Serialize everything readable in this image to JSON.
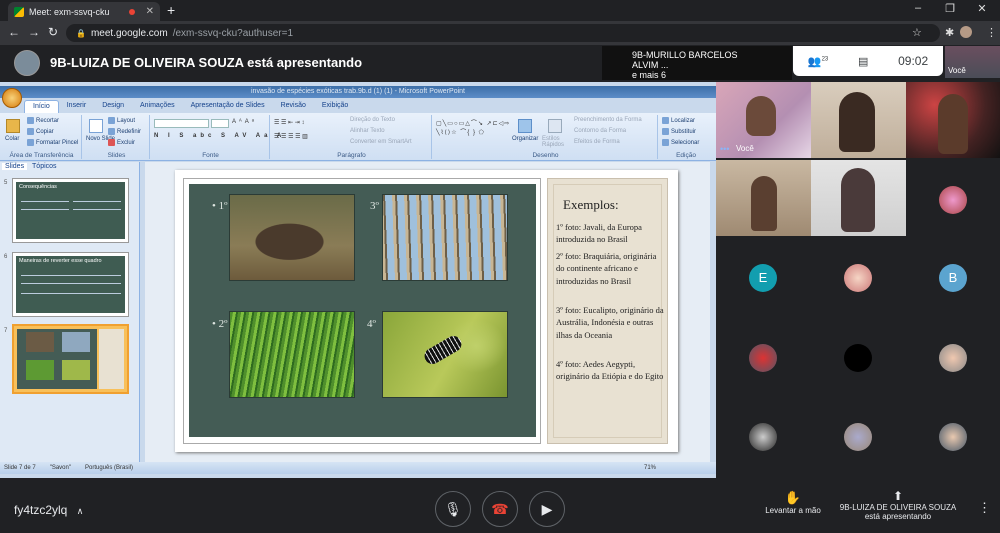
{
  "browser": {
    "tab_title": "Meet: exm-ssvq-cku",
    "url_host": "meet.google.com",
    "url_path": "/exm-ssvq-cku?authuser=1",
    "new_tab": "+",
    "minimize": "–",
    "maximize": "❐",
    "close": "✕",
    "back": "←",
    "forward": "→",
    "reload": "↻",
    "star": "☆",
    "extensions": "✱",
    "menu": "⋮"
  },
  "meet": {
    "presenting_banner": "9B-LUIZA DE OLIVEIRA SOUZA está apresentando",
    "pinned_name": "9B-MURILLO BARCELOS ALVIM ...",
    "pinned_more": "e mais 6",
    "participants_count": "23",
    "time": "09:02",
    "self_label": "Você",
    "meeting_code": "fy4tzc2ylq",
    "raise_hand_label": "Levantar a mão",
    "presenter_label": "9B-LUIZA DE OLIVEIRA SOUZA",
    "presenter_sub": "está apresentando",
    "tile_letters": [
      "E",
      "B"
    ]
  },
  "powerpoint": {
    "window_title": "invasão de espécies exóticas trab.9b.d (1) (1) - Microsoft PowerPoint",
    "tabs": [
      "Início",
      "Inserir",
      "Design",
      "Animações",
      "Apresentação de Slides",
      "Revisão",
      "Exibição"
    ],
    "groups": {
      "clipboard": "Área de Transferência",
      "slides": "Slides",
      "font": "Fonte",
      "paragraph": "Parágrafo",
      "drawing": "Desenho",
      "editing": "Edição"
    },
    "clipboard_items": [
      "Colar",
      "Recortar",
      "Copiar",
      "Formatar Pincel"
    ],
    "slides_items": [
      "Novo Slide",
      "Layout",
      "Redefinir",
      "Excluir"
    ],
    "paragraph_items": [
      "Direção do Texto",
      "Alinhar Texto",
      "Converter em SmartArt"
    ],
    "drawing_items": [
      "Organizar",
      "Estilos Rápidos",
      "Preenchimento da Forma",
      "Contorno da Forma",
      "Efeitos de Forma"
    ],
    "editing_items": [
      "Localizar",
      "Substituir",
      "Selecionar"
    ],
    "panel_tabs": [
      "Slides",
      "Tópicos"
    ],
    "thumbs": [
      {
        "num": "5",
        "title": "Consequências"
      },
      {
        "num": "6",
        "title": "Maneiras de reverter esse quadro"
      },
      {
        "num": "7",
        "title": ""
      }
    ],
    "status": {
      "slide": "Slide 7 de 7",
      "theme": "\"Savon\"",
      "lang": "Português (Brasil)",
      "zoom": "71%"
    }
  },
  "slide": {
    "markers": [
      "• 1º",
      "3º",
      "• 2º",
      "4º"
    ],
    "title": "Exemplos:",
    "items": [
      "1º foto: Javali, da Europa introduzida no Brasil",
      "2º foto: Braquiária, originária do continente africano e introduzidas no Brasil",
      "3º foto: Eucalipto, originário da Austrália, Indonésia e outras ilhas da Oceania",
      "4º foto: Aedes Aegypti, originário da Etiópia e do Egito"
    ]
  }
}
